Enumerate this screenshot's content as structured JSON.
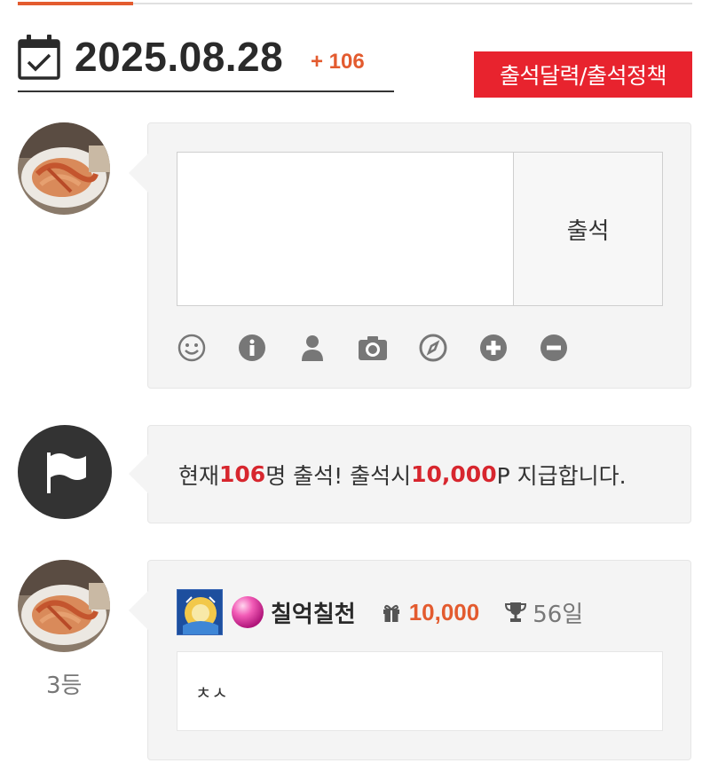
{
  "header": {
    "date": "2025.08.28",
    "count_badge": "+ 106",
    "policy_button_label": "출석달력/출석정책"
  },
  "compose": {
    "comment_placeholder": "",
    "submit_label": "출석",
    "tools": [
      "smile-icon",
      "info-icon",
      "user-icon",
      "camera-icon",
      "compass-icon",
      "plus-circle-icon",
      "minus-circle-icon"
    ]
  },
  "notice": {
    "prefix": "현재 ",
    "attendee_count": "106",
    "middle": "명 출석! 출석시 ",
    "points": "10,000",
    "suffix": "P 지급합니다."
  },
  "entries": [
    {
      "rank": "3등",
      "nickname": "칠억칠천",
      "points": "10,000",
      "days": "56일",
      "message": "ㅊㅅ"
    }
  ],
  "colors": {
    "accent": "#e35b2f",
    "red": "#d7262e",
    "policy_button": "#e8232e",
    "bubble_bg": "#f4f4f4"
  }
}
